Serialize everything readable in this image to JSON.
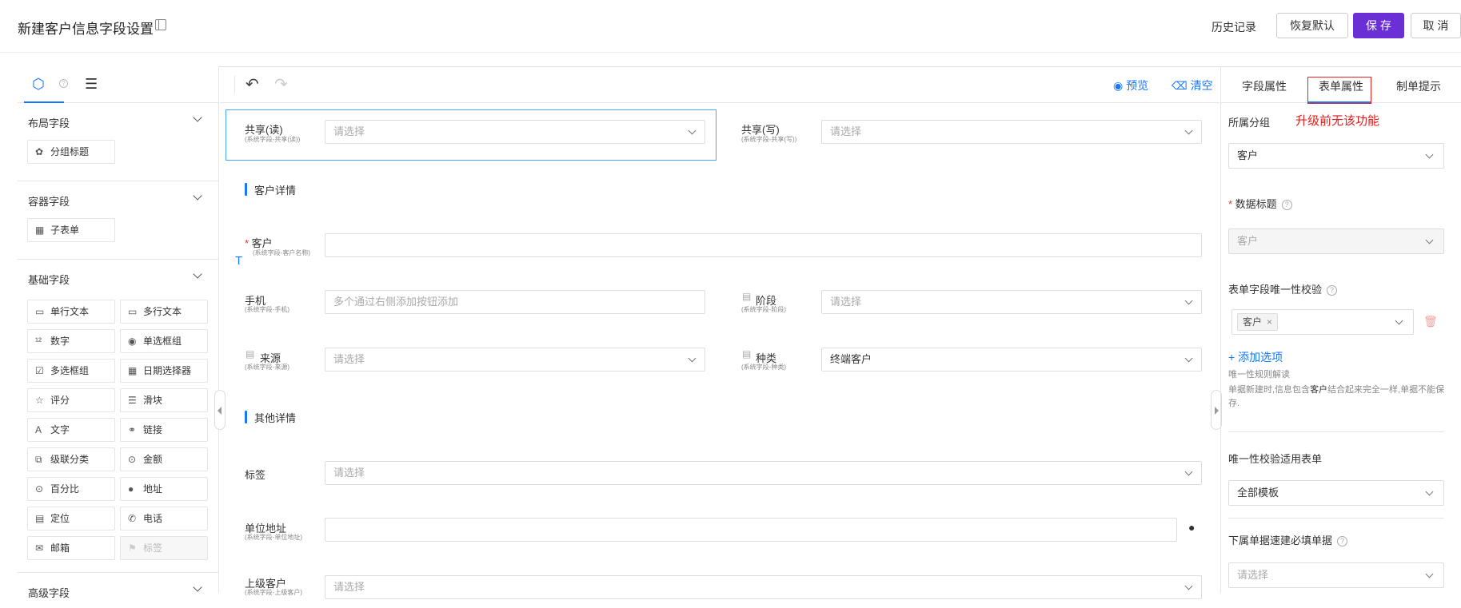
{
  "header": {
    "title": "新建客户信息字段设置",
    "history": "历史记录",
    "restore": "恢复默认",
    "save": "保 存",
    "cancel": "取 消"
  },
  "left": {
    "sections": [
      {
        "title": "布局字段",
        "items": [
          "分组标题"
        ]
      },
      {
        "title": "容器字段",
        "items": [
          "子表单"
        ]
      },
      {
        "title": "基础字段",
        "items": [
          "单行文本",
          "多行文本",
          "数字",
          "单选框组",
          "多选框组",
          "日期选择器",
          "评分",
          "滑块",
          "文字",
          "链接",
          "级联分类",
          "金额",
          "百分比",
          "地址",
          "定位",
          "电话",
          "邮箱",
          "标签"
        ]
      },
      {
        "title": "高级字段"
      }
    ]
  },
  "toolbar": {
    "preview": "预览",
    "clear": "清空"
  },
  "form": {
    "share_read": {
      "label": "共享(读)",
      "sub": "(系统字段-共享(读))",
      "placeholder": "请选择"
    },
    "share_write": {
      "label": "共享(写)",
      "sub": "(系统字段-共享(写))",
      "placeholder": "请选择"
    },
    "group1": "客户详情",
    "customer": {
      "label": "客户",
      "sub": "(系统字段-客户名称)"
    },
    "text_marker": "T",
    "phone": {
      "label": "手机",
      "sub": "(系统字段-手机)",
      "placeholder": "多个通过右侧添加按钮添加"
    },
    "stage": {
      "label": "阶段",
      "sub": "(系统字段-阶段)",
      "placeholder": "请选择"
    },
    "source": {
      "label": "来源",
      "sub": "(系统字段-来源)",
      "placeholder": "请选择"
    },
    "kind": {
      "label": "种类",
      "sub": "(系统字段-种类)",
      "value": "终端客户"
    },
    "group2": "其他详情",
    "tags": {
      "label": "标签",
      "placeholder": "请选择"
    },
    "address": {
      "label": "单位地址",
      "sub": "(系统字段-单位地址)"
    },
    "parent": {
      "label": "上级客户",
      "sub": "(系统字段-上级客户)",
      "placeholder": "请选择"
    }
  },
  "right": {
    "tabs": [
      "字段属性",
      "表单属性",
      "制单提示"
    ],
    "upgrade_note": "升级前无该功能",
    "group_label": "所属分组",
    "group_value": "客户",
    "data_title_label": "数据标题",
    "data_title_value": "客户",
    "unique_label": "表单字段唯一性校验",
    "unique_tag": "客户",
    "add_option": "+ 添加选项",
    "rule_title": "唯一性规则解读",
    "rule_text_1": "单据新建时,信息包含",
    "rule_text_bold": "客户",
    "rule_text_2": "结合起来完全一样,单据不能保存.",
    "apply_label": "唯一性校验适用表单",
    "apply_value": "全部模板",
    "sub_label": "下属单据速建必填单据",
    "sub_placeholder": "请选择"
  }
}
